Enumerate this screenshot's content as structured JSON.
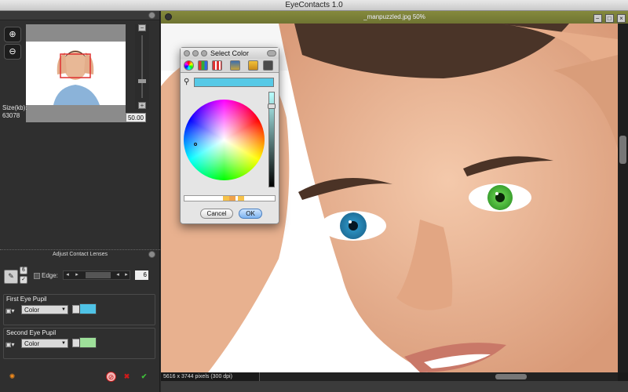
{
  "window": {
    "title": "EyeContacts 1.0"
  },
  "document": {
    "title": "_manpuzzled.jpg 50%",
    "status": "5616 x 3744 pixels (300 dpi)"
  },
  "navigator": {
    "size_label": "Size(kb):",
    "size_value": "63078",
    "zoom_value": "50.00"
  },
  "adjust": {
    "section_title": "Adjust Contact Lenses",
    "edge_label": "Edge:",
    "edge_value": "6"
  },
  "first_eye": {
    "title": "First Eye Pupil",
    "mode": "Color",
    "swatch_color": "#4fc3e6"
  },
  "second_eye": {
    "title": "Second Eye Pupil",
    "mode": "Color",
    "swatch_color": "#9ee09a"
  },
  "color_dialog": {
    "title": "Select Color",
    "selected_color": "#57c9e6",
    "cancel_label": "Cancel",
    "ok_label": "OK"
  },
  "icons": {
    "zoom_in": "zoom-in-icon",
    "zoom_out": "zoom-out-icon",
    "settings": "gear-icon",
    "reset": "reset-icon",
    "cancel": "cancel-icon",
    "apply": "checkmark-icon"
  }
}
